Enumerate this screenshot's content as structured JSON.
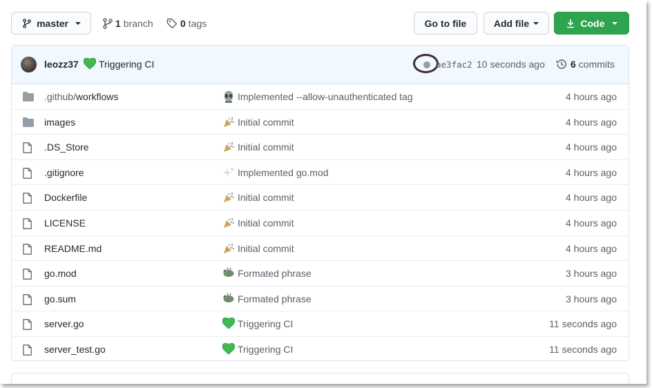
{
  "toolbar": {
    "branch_name": "master",
    "branches_count": "1",
    "branches_label": "branch",
    "tags_count": "0",
    "tags_label": "tags",
    "go_to_file": "Go to file",
    "add_file": "Add file",
    "code": "Code"
  },
  "latest_commit": {
    "author": "leozz37",
    "emoji": "💚",
    "message": "Triggering CI",
    "sha": "ae3fac2",
    "time": "10 seconds ago",
    "commits_count": "6",
    "commits_label": "commits"
  },
  "files": [
    {
      "type": "folder",
      "name_prefix": ".github/",
      "name": "workflows",
      "emoji": "👽",
      "message": "Implemented --allow-unauthenticated tag",
      "age": "4 hours ago"
    },
    {
      "type": "folder",
      "name_prefix": "",
      "name": "images",
      "emoji": "🎉",
      "message": "Initial commit",
      "age": "4 hours ago"
    },
    {
      "type": "file",
      "name_prefix": "",
      "name": ".DS_Store",
      "emoji": "🎉",
      "message": "Initial commit",
      "age": "4 hours ago"
    },
    {
      "type": "file",
      "name_prefix": "",
      "name": ".gitignore",
      "emoji": "✨",
      "message": "Implemented go.mod",
      "age": "4 hours ago"
    },
    {
      "type": "file",
      "name_prefix": "",
      "name": "Dockerfile",
      "emoji": "🎉",
      "message": "Initial commit",
      "age": "4 hours ago"
    },
    {
      "type": "file",
      "name_prefix": "",
      "name": "LICENSE",
      "emoji": "🎉",
      "message": "Initial commit",
      "age": "4 hours ago"
    },
    {
      "type": "file",
      "name_prefix": "",
      "name": "README.md",
      "emoji": "🎉",
      "message": "Initial commit",
      "age": "4 hours ago"
    },
    {
      "type": "file",
      "name_prefix": "",
      "name": "go.mod",
      "emoji": "🐛",
      "message": "Formated phrase",
      "age": "3 hours ago"
    },
    {
      "type": "file",
      "name_prefix": "",
      "name": "go.sum",
      "emoji": "🐛",
      "message": "Formated phrase",
      "age": "3 hours ago"
    },
    {
      "type": "file",
      "name_prefix": "",
      "name": "server.go",
      "emoji": "💚",
      "message": "Triggering CI",
      "age": "11 seconds ago"
    },
    {
      "type": "file",
      "name_prefix": "",
      "name": "server_test.go",
      "emoji": "💚",
      "message": "Triggering CI",
      "age": "11 seconds ago"
    }
  ],
  "colors": {
    "primary_button": "#2ea44f",
    "header_bg": "#f1f8ff",
    "muted_text": "#586069",
    "highlight_ring": "#3d2a32"
  }
}
